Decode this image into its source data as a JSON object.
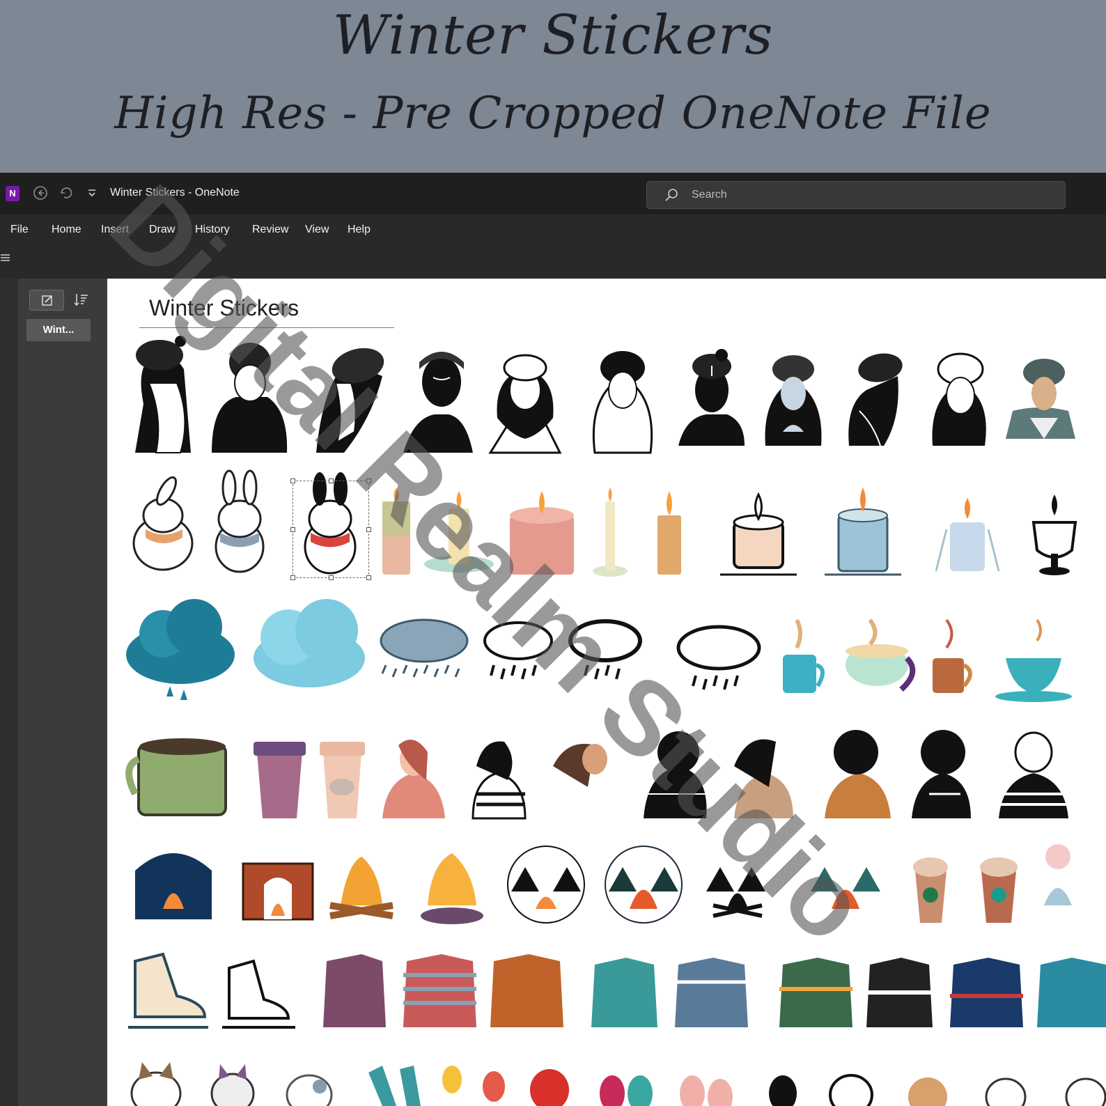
{
  "banner": {
    "title": "Winter Stickers",
    "subtitle": "High Res - Pre Cropped OneNote File"
  },
  "window": {
    "title": "Winter Stickers  -  OneNote",
    "search_placeholder": "Search",
    "menu": [
      "File",
      "Home",
      "Insert",
      "Draw",
      "History",
      "Review",
      "View",
      "Help"
    ],
    "pages": [
      {
        "label": "Wint..."
      }
    ]
  },
  "page": {
    "title": "Winter Stickers",
    "sticker_rows": [
      {
        "theme": "women in beanies",
        "count": 11
      },
      {
        "theme": "bunnies and candles",
        "count": 12
      },
      {
        "theme": "clouds and hot drinks",
        "count": 10
      },
      {
        "theme": "mugs and women with drinks",
        "count": 12
      },
      {
        "theme": "fireplaces, campfires and frappes",
        "count": 11
      },
      {
        "theme": "ice skates and sweaters",
        "count": 11
      },
      {
        "theme": "cats, scarves, mittens and dogs",
        "count": 12
      }
    ]
  },
  "watermark": "Digital Realm Studio",
  "colors": {
    "banner_bg": "#7e8794",
    "onenote_purple": "#7719aa",
    "titlebar": "#1f1f1f",
    "ribbon": "#292929",
    "canvas": "#ffffff"
  }
}
